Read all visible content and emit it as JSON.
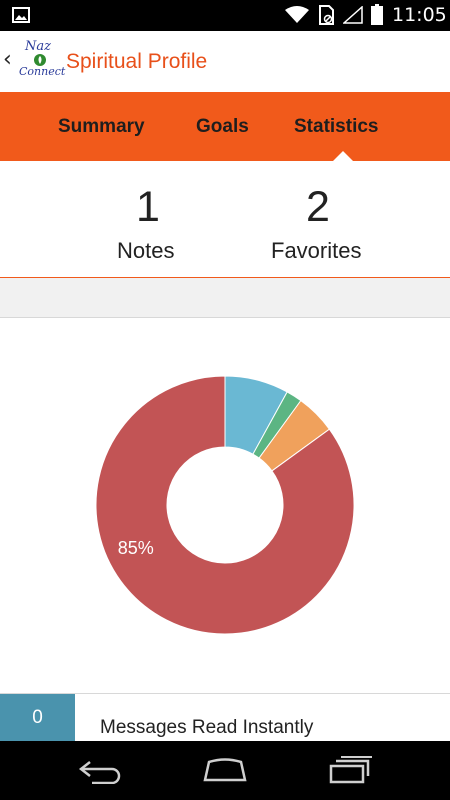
{
  "status_bar": {
    "time": "11:05",
    "icons": [
      "gallery-icon",
      "wifi-icon",
      "sim-icon",
      "signal-icon",
      "battery-icon"
    ]
  },
  "header": {
    "title": "Spiritual Profile",
    "logo_top": "Naz",
    "logo_bottom": "Connect",
    "back_icon": "‹",
    "title_color": "#e8501a",
    "logo_text_color": "#2a3b9a"
  },
  "tabs": [
    {
      "label": "Summary",
      "selected": false
    },
    {
      "label": "Goals",
      "selected": false
    },
    {
      "label": "Statistics",
      "selected": true
    }
  ],
  "tab_bar_color": "#f15a1b",
  "stats": {
    "notes": {
      "value": "1",
      "label": "Notes"
    },
    "favorites": {
      "value": "2",
      "label": "Favorites"
    }
  },
  "chart_data": {
    "type": "pie",
    "donut": true,
    "slices": [
      {
        "value": 8,
        "color": "#6ab8d3"
      },
      {
        "value": 2,
        "color": "#5cb583"
      },
      {
        "value": 5,
        "color": "#f0a15c"
      },
      {
        "value": 85,
        "color": "#c25455",
        "label": "85%"
      }
    ]
  },
  "list": {
    "rows": [
      {
        "count": "0",
        "label": "Messages Read Instantly",
        "color": "#4a93ad"
      }
    ]
  },
  "nav_bar": {
    "icons": [
      "nav-back-icon",
      "nav-home-icon",
      "nav-recents-icon"
    ]
  }
}
